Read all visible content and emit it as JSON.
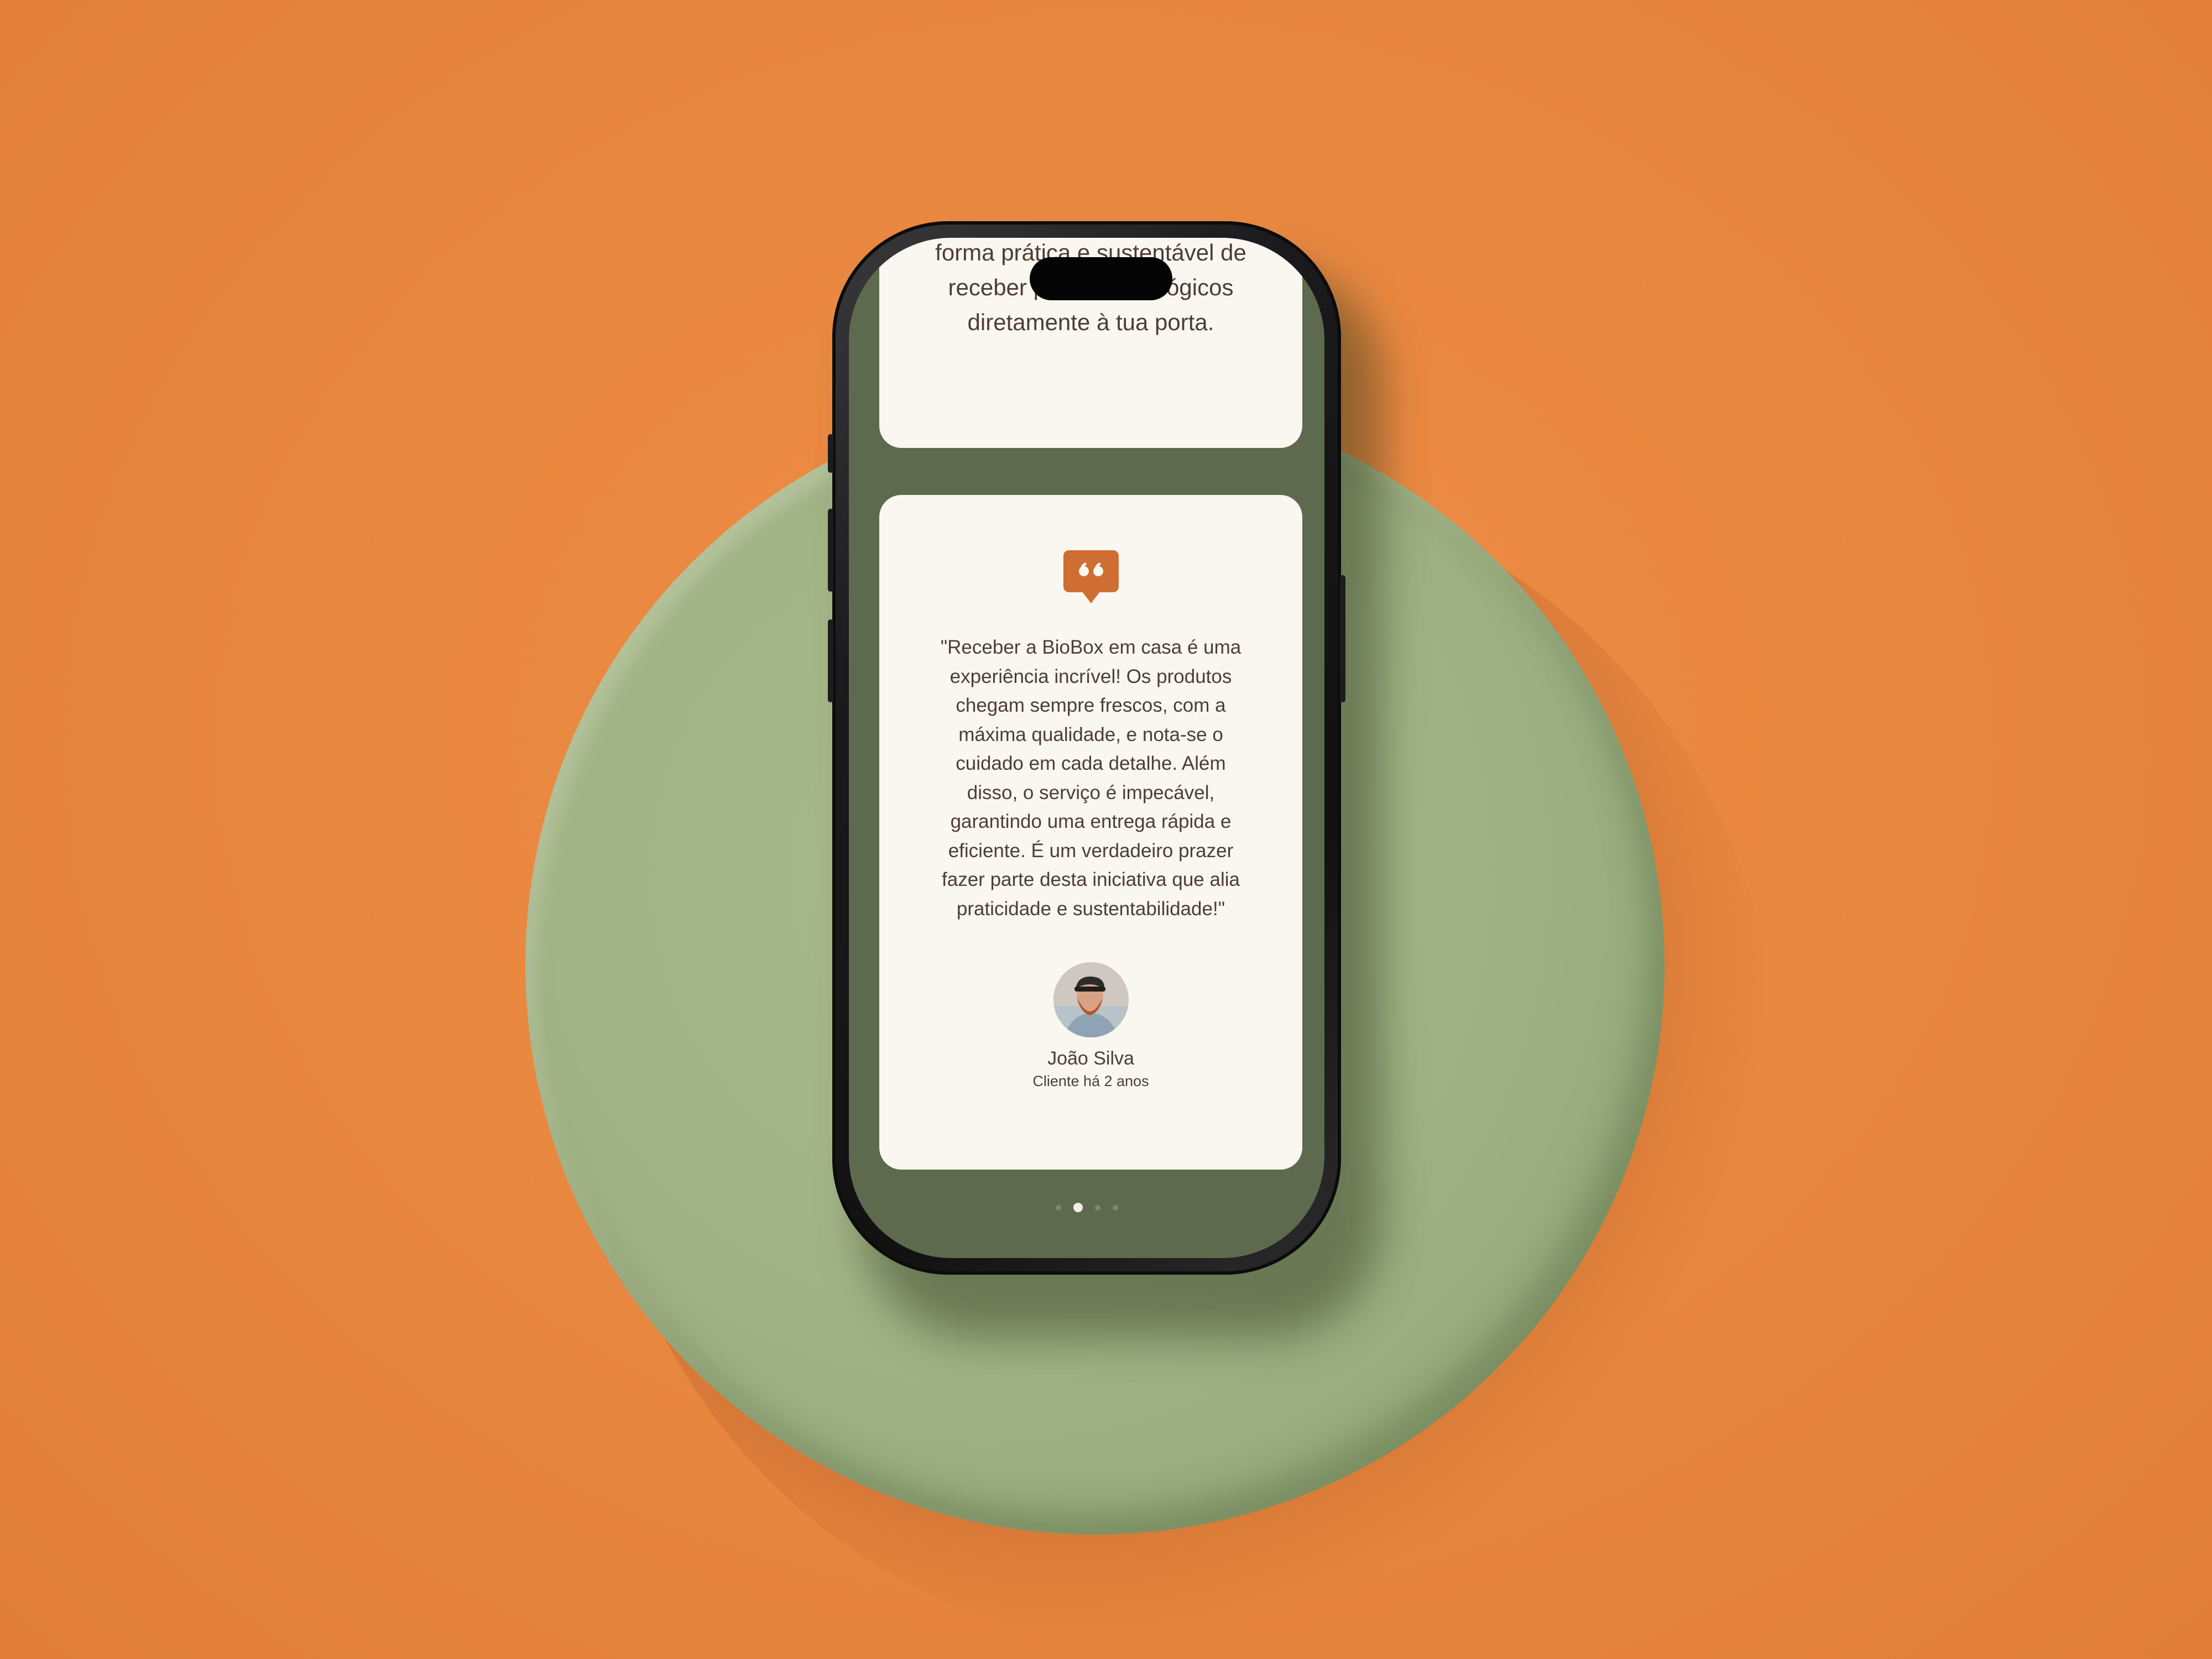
{
  "colors": {
    "background": "#e8873f",
    "pedestal": "#a2b486",
    "screen_bg": "#5e6a4e",
    "card_bg": "#faf7f0",
    "accent": "#cf6e32",
    "text": "#4d3d36"
  },
  "intro": {
    "text": "forma prática e sustentável de receber produtos biológicos diretamente à tua porta."
  },
  "testimonial": {
    "icon": "quote-bubble-icon",
    "quote": "\"Receber a BioBox em casa é uma experiência incrível! Os produtos chegam sempre frescos, com a máxima qualidade, e nota-se o cuidado em cada detalhe. Além disso, o serviço é impecável, garantindo uma entrega rápida e eficiente. É um verdadeiro prazer fazer parte desta iniciativa que alia praticidade e sustentabilidade!\"",
    "author_name": "João Silva",
    "author_meta": "Cliente há 2 anos"
  },
  "carousel": {
    "total": 4,
    "active_index": 1
  }
}
